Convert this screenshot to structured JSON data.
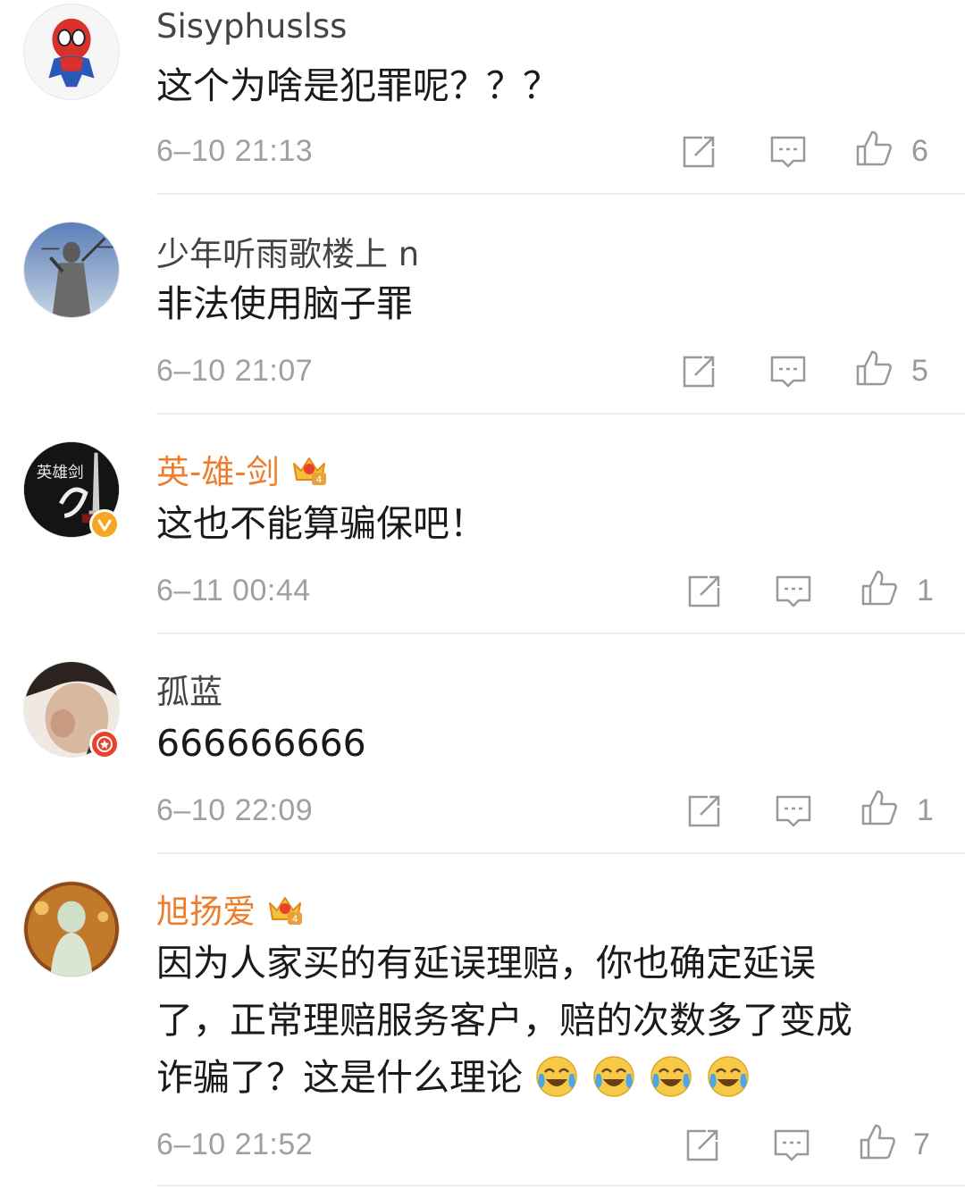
{
  "comments": [
    {
      "username": "Sisyphuslss",
      "text": "这个为啥是犯罪呢？？？",
      "time": "6–10 21:13",
      "likes": "6",
      "vip": false
    },
    {
      "username": "少年听雨歌楼上 n",
      "text": "非法使用脑子罪",
      "time": "6–10 21:07",
      "likes": "5",
      "vip": false
    },
    {
      "username": "英-雄-剑",
      "text": "这也不能算骗保吧！",
      "time": "6–11 00:44",
      "likes": "1",
      "vip": true,
      "vip_level": "4"
    },
    {
      "username": "孤蓝",
      "text": "666666666",
      "time": "6–10 22:09",
      "likes": "1",
      "vip": false
    },
    {
      "username": "旭扬爱",
      "text_lines": [
        "因为人家买的有延误理赔，你也确定延误",
        "了，正常理赔服务客户，赔的次数多了变成",
        "诈骗了？这是什么理论"
      ],
      "time": "6–10 21:52",
      "likes": "7",
      "vip": true,
      "vip_level": "4",
      "emoji": "laugh-cry-emoji",
      "emoji_count": 4
    }
  ],
  "avatar1_text": "英雄剑",
  "icons": {
    "repost": "repost-icon",
    "comment": "comment-icon",
    "like": "thumbs-up-icon"
  },
  "colors": {
    "vip_name": "#ee7e2d",
    "verified": "#f5a623",
    "red_badge": "#e8412c"
  }
}
